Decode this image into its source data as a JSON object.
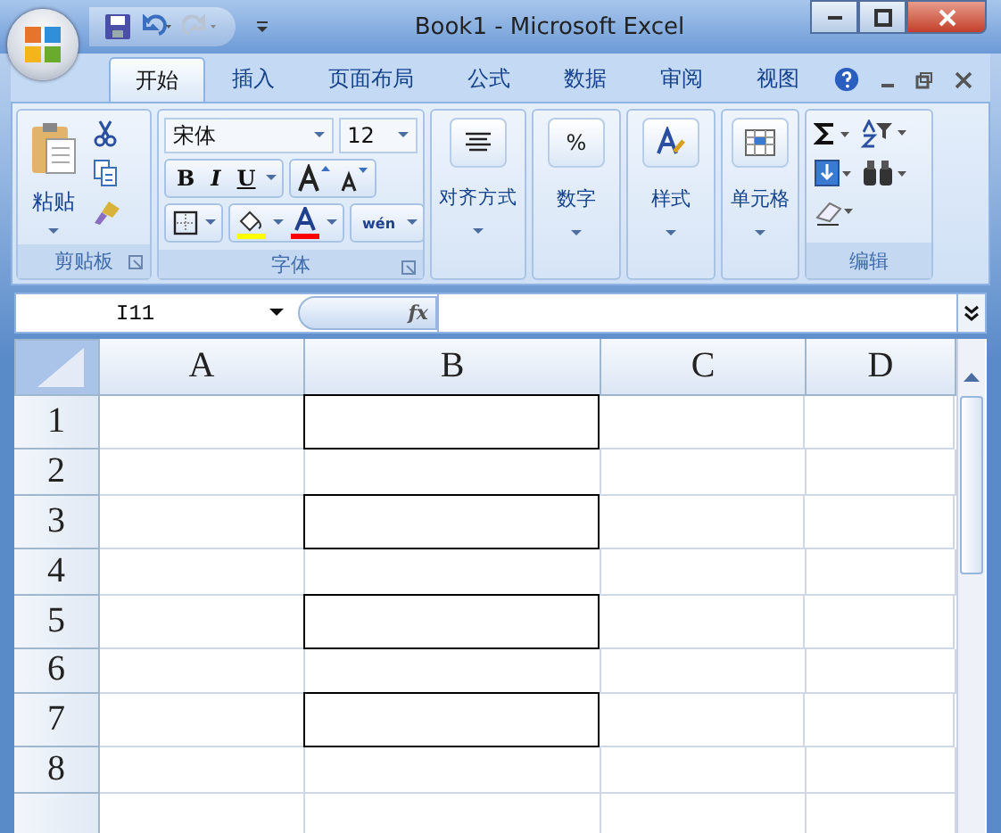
{
  "window": {
    "title": "Book1 - Microsoft Excel"
  },
  "tabs": [
    {
      "label": "开始",
      "selected": true
    },
    {
      "label": "插入",
      "selected": false
    },
    {
      "label": "页面布局",
      "selected": false
    },
    {
      "label": "公式",
      "selected": false
    },
    {
      "label": "数据",
      "selected": false
    },
    {
      "label": "审阅",
      "selected": false
    },
    {
      "label": "视图",
      "selected": false
    }
  ],
  "ribbon": {
    "clipboard": {
      "paste_label": "粘贴",
      "group_label": "剪贴板"
    },
    "font": {
      "font_name": "宋体",
      "font_size": "12",
      "style_buttons": [
        "B",
        "I",
        "U"
      ],
      "phonetic": "wén",
      "group_label": "字体"
    },
    "big_groups": [
      {
        "label": "对齐方式",
        "kind": "align"
      },
      {
        "label": "数字",
        "kind": "number",
        "symbol": "%"
      },
      {
        "label": "样式",
        "kind": "styles"
      },
      {
        "label": "单元格",
        "kind": "cells"
      }
    ],
    "editing": {
      "group_label": "编辑"
    }
  },
  "formula_bar": {
    "name_box": "I11",
    "fx": "fx"
  },
  "sheet": {
    "columns": [
      "A",
      "B",
      "C",
      "D"
    ],
    "rows": [
      {
        "label": "1",
        "b_bordered": true
      },
      {
        "label": "2",
        "b_bordered": false
      },
      {
        "label": "3",
        "b_bordered": true
      },
      {
        "label": "4",
        "b_bordered": false
      },
      {
        "label": "5",
        "b_bordered": true
      },
      {
        "label": "6",
        "b_bordered": false
      },
      {
        "label": "7",
        "b_bordered": true
      },
      {
        "label": "8",
        "b_bordered": false
      }
    ]
  }
}
